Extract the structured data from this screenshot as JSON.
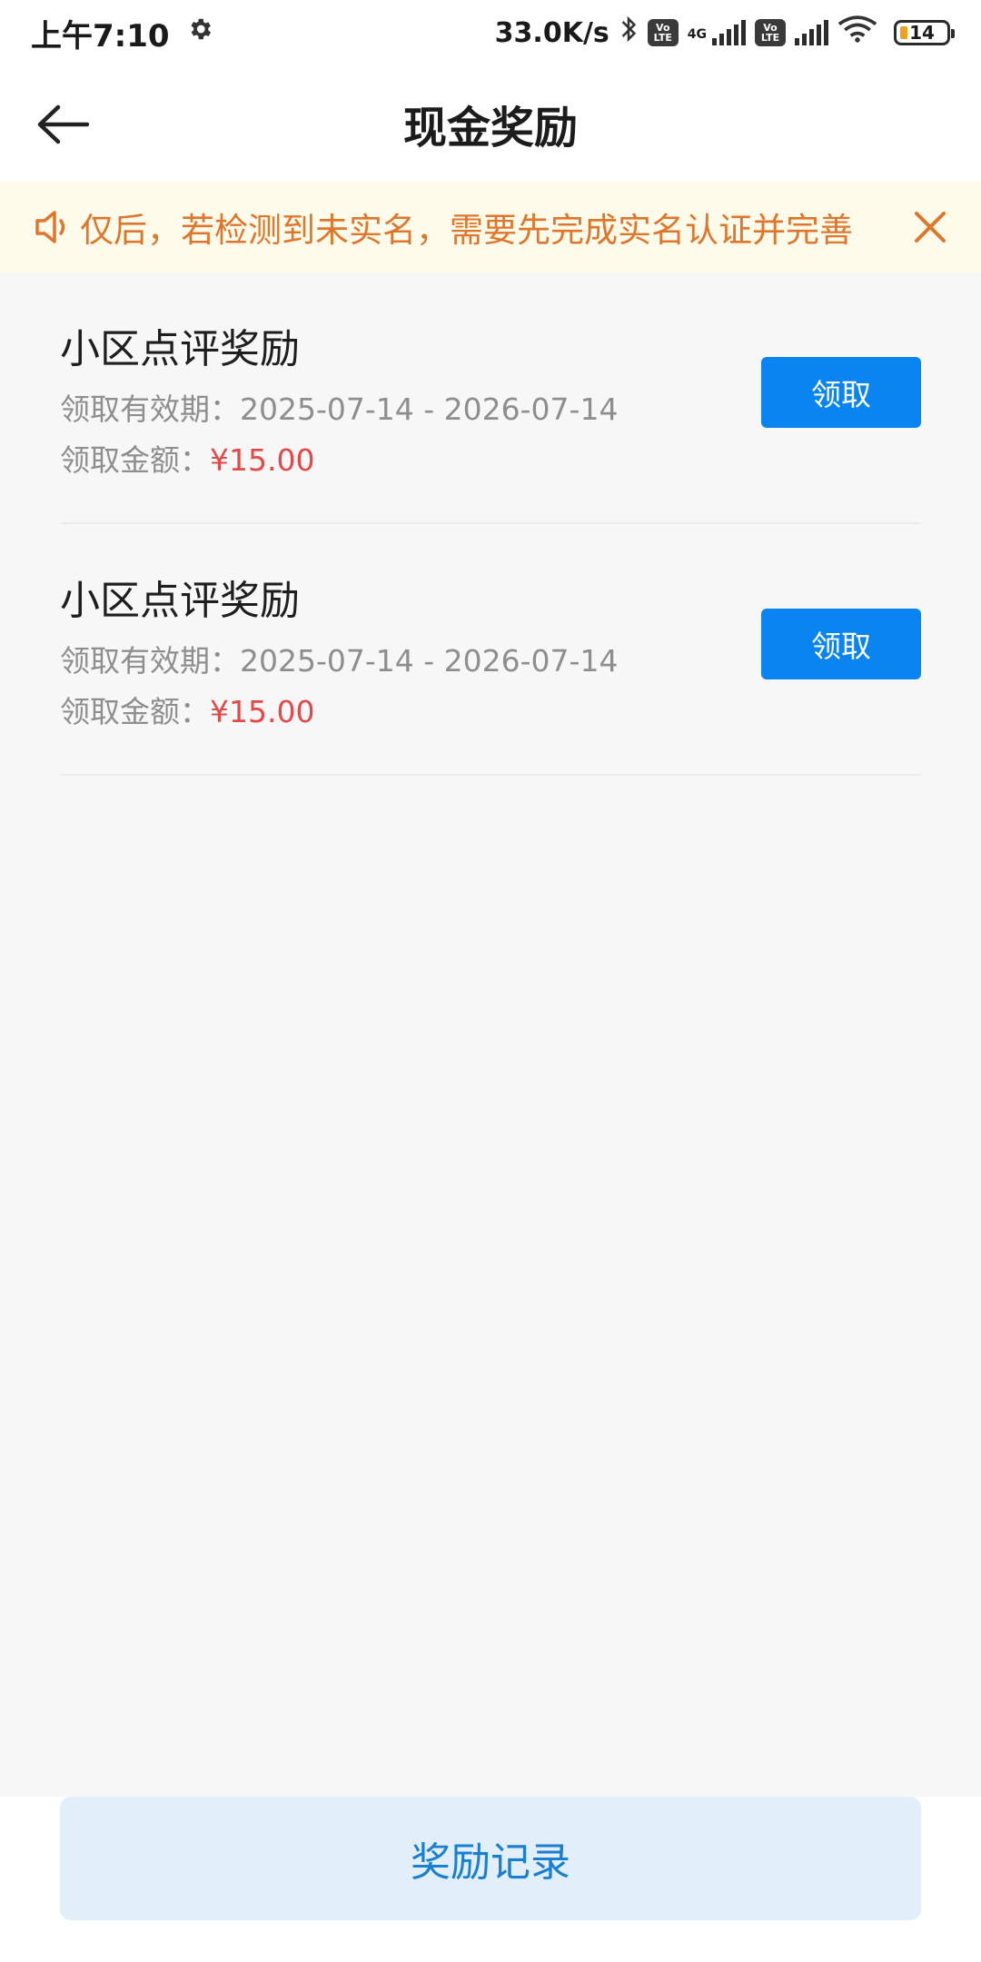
{
  "status_bar": {
    "time": "上午7:10",
    "network_speed": "33.0K/s",
    "network_type": "4G",
    "volte_label": "Vo LTE",
    "battery": "14",
    "battery_color": "#f0a020"
  },
  "header": {
    "title": "现金奖励",
    "back_icon": "arrow-left-icon"
  },
  "notice": {
    "text": "仅后，若检测到未实名，需要先完成实名认证并完善",
    "color": "#e0762c",
    "background": "#fffbeb"
  },
  "rewards": [
    {
      "title": "小区点评奖励",
      "validity_label": "领取有效期：",
      "validity": "2025-07-14 - 2026-07-14",
      "amount_label": "领取金额：",
      "amount": "¥15.00",
      "button": "领取"
    },
    {
      "title": "小区点评奖励",
      "validity_label": "领取有效期：",
      "validity": "2025-07-14 - 2026-07-14",
      "amount_label": "领取金额：",
      "amount": "¥15.00",
      "button": "领取"
    }
  ],
  "bottom": {
    "records_button": "奖励记录"
  },
  "colors": {
    "accent": "#0a84f0",
    "amount": "#e54848",
    "records_bg": "#e2effa"
  }
}
